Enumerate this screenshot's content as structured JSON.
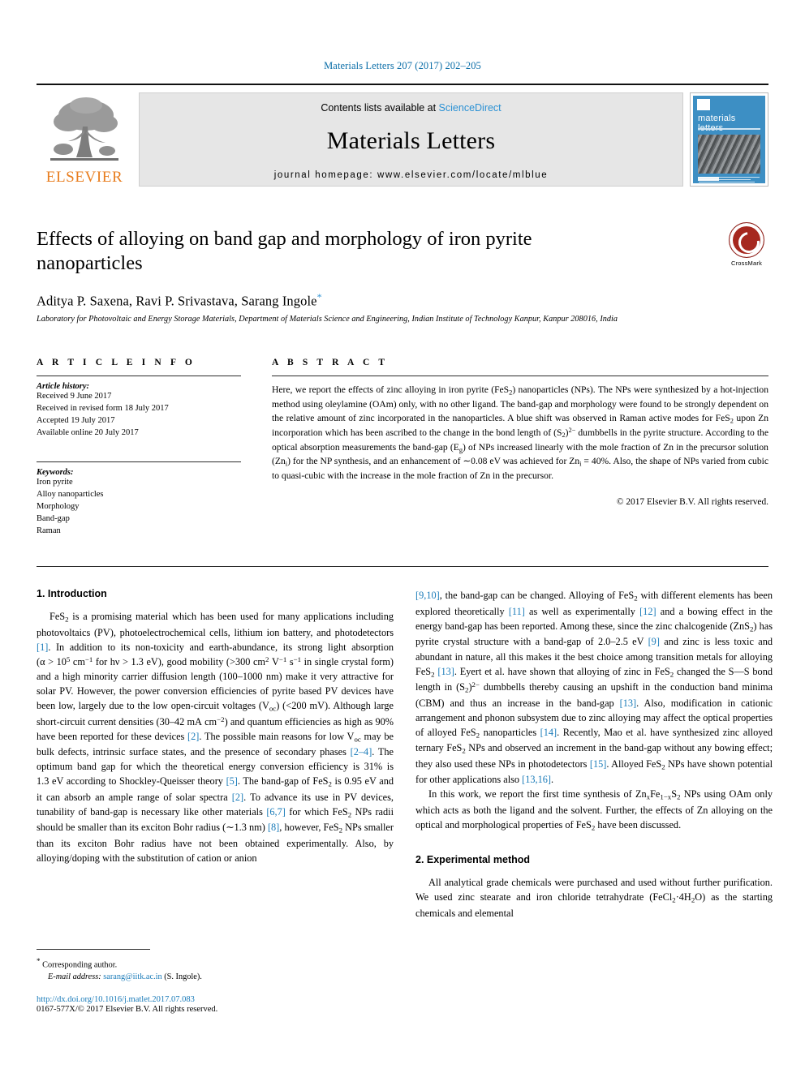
{
  "running_head": "Materials Letters 207 (2017) 202–205",
  "masthead": {
    "publisher_word": "ELSEVIER",
    "contents_prefix": "Contents lists available at ",
    "contents_link": "ScienceDirect",
    "journal_name": "Materials Letters",
    "homepage": "journal homepage: www.elsevier.com/locate/mlblue",
    "cover_title": "materials letters"
  },
  "article": {
    "title": "Effects of alloying on band gap and morphology of iron pyrite nanoparticles",
    "authors": "Aditya P. Saxena, Ravi P. Srivastava, Sarang Ingole",
    "corresponding_marker": "*",
    "affiliation": "Laboratory for Photovoltaic and Energy Storage Materials, Department of Materials Science and Engineering, Indian Institute of Technology Kanpur, Kanpur 208016, India",
    "crossmark_label": "CrossMark"
  },
  "info": {
    "heading": "A R T I C L E   I N F O",
    "history_label": "Article history:",
    "history": [
      "Received 9 June 2017",
      "Received in revised form 18 July 2017",
      "Accepted 19 July 2017",
      "Available online 20 July 2017"
    ],
    "keywords_label": "Keywords:",
    "keywords": [
      "Iron pyrite",
      "Alloy nanoparticles",
      "Morphology",
      "Band-gap",
      "Raman"
    ]
  },
  "abstract": {
    "heading": "A B S T R A C T",
    "text": "Here, we report the effects of zinc alloying in iron pyrite (FeS2) nanoparticles (NPs). The NPs were synthesized by a hot-injection method using oleylamine (OAm) only, with no other ligand. The band-gap and morphology were found to be strongly dependent on the relative amount of zinc incorporated in the nanoparticles. A blue shift was observed in Raman active modes for FeS2 upon Zn incorporation which has been ascribed to the change in the bond length of (S2)2− dumbbells in the pyrite structure. According to the optical absorption measurements the band-gap (Eg) of NPs increased linearly with the mole fraction of Zn in the precursor solution (Zni) for the NP synthesis, and an enhancement of ~0.08 eV was achieved for Zni = 40%. Also, the shape of NPs varied from cubic to quasi-cubic with the increase in the mole fraction of Zn in the precursor.",
    "copyright": "© 2017 Elsevier B.V. All rights reserved."
  },
  "sections": {
    "intro_heading": "1. Introduction",
    "experimental_heading": "2. Experimental method",
    "intro_p1": "FeS2 is a promising material which has been used for many applications including photovoltaics (PV), photoelectrochemical cells, lithium ion battery, and photodetectors [1]. In addition to its non-toxicity and earth-abundance, its strong light absorption (α > 10^5 cm−1 for hν > 1.3 eV), good mobility (>300 cm2 V−1 s−1 in single crystal form) and a high minority carrier diffusion length (100–1000 nm) make it very attractive for solar PV. However, the power conversion efficiencies of pyrite based PV devices have been low, largely due to the low open-circuit voltages (Voc) (<200 mV). Although large short-circuit current densities (30–42 mA cm−2) and quantum efficiencies as high as 90% have been reported for these devices [2]. The possible main reasons for low Voc may be bulk defects, intrinsic surface states, and the presence of secondary phases [2–4]. The optimum band gap for which the theoretical energy conversion efficiency is 31% is 1.3 eV according to Shockley-Queisser theory [5]. The band-gap of FeS2 is 0.95 eV and it can absorb an ample range of solar spectra [2]. To advance its use in PV devices, tunability of band-gap is necessary like other materials [6,7] for which FeS2 NPs radii should be smaller than its exciton Bohr radius (~1.3 nm) [8], however, FeS2 NPs smaller than its exciton Bohr radius have not been obtained experimentally. Also, by alloying/doping with the substitution of cation or anion",
    "intro_p2": "[9,10], the band-gap can be changed. Alloying of FeS2 with different elements has been explored theoretically [11] as well as experimentally [12] and a bowing effect in the energy band-gap has been reported. Among these, since the zinc chalcogenide (ZnS2) has pyrite crystal structure with a band-gap of 2.0–2.5 eV [9] and zinc is less toxic and abundant in nature, all this makes it the best choice among transition metals for alloying FeS2 [13]. Eyert et al. have shown that alloying of zinc in FeS2 changed the S—S bond length in (S2)2− dumbbells thereby causing an upshift in the conduction band minima (CBM) and thus an increase in the band-gap [13]. Also, modification in cationic arrangement and phonon subsystem due to zinc alloying may affect the optical properties of alloyed FeS2 nanoparticles [14]. Recently, Mao et al. have synthesized zinc alloyed ternary FeS2 NPs and observed an increment in the band-gap without any bowing effect; they also used these NPs in photodetectors [15]. Alloyed FeS2 NPs have shown potential for other applications also [13,16].",
    "intro_p3": "In this work, we report the first time synthesis of ZnxFe1−xS2 NPs using OAm only which acts as both the ligand and the solvent. Further, the effects of Zn alloying on the optical and morphological properties of FeS2 have been discussed.",
    "experimental_p1": "All analytical grade chemicals were purchased and used without further purification. We used zinc stearate and iron chloride tetrahydrate (FeCl2·4H2O) as the starting chemicals and elemental"
  },
  "footer": {
    "corresponding": "Corresponding author.",
    "email_label": "E-mail address:",
    "email": "sarang@iitk.ac.in",
    "email_owner": "(S. Ingole).",
    "doi": "http://dx.doi.org/10.1016/j.matlet.2017.07.083",
    "issn": "0167-577X/© 2017 Elsevier B.V. All rights reserved."
  },
  "colors": {
    "link": "#1a7bb9",
    "header_blue": "#0b6ea8",
    "elsevier_orange": "#e87d1e",
    "crossmark_red": "#a6281f"
  }
}
